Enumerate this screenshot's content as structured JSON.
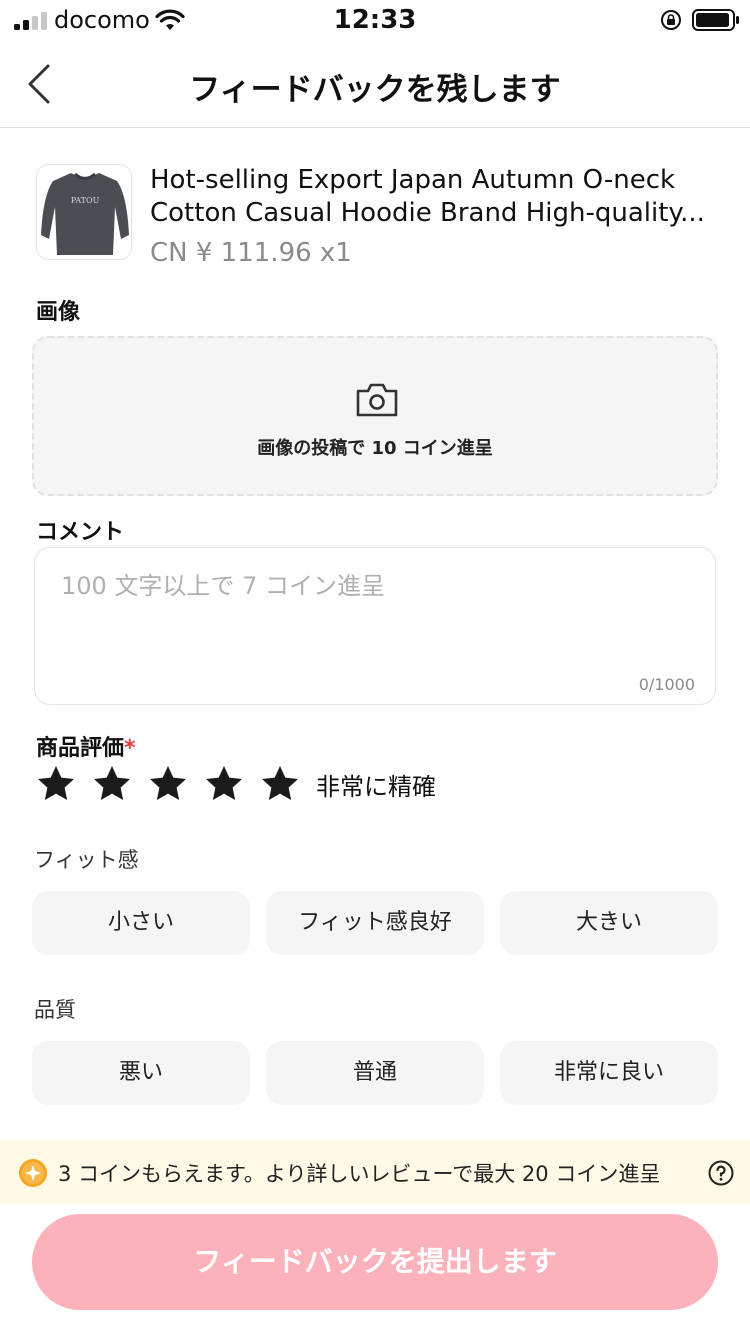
{
  "status_bar": {
    "carrier": "docomo",
    "time": "12:33"
  },
  "nav": {
    "title": "フィードバックを残します",
    "back_icon": "chevron-left-icon"
  },
  "product": {
    "shirt_print": "PATOU",
    "name": "Hot-selling Export Japan Autumn O-neck Cotton Casual Hoodie Brand High-quality...",
    "price": "CN ¥ 111.96 x1"
  },
  "image_section": {
    "label": "画像",
    "upload_text": "画像の投稿で 10 コイン進呈",
    "icon": "camera-icon"
  },
  "comment_section": {
    "label": "コメント",
    "placeholder": "100 文字以上で 7 コイン進呈",
    "value": "",
    "counter": "0/1000"
  },
  "rating_section": {
    "label": "商品評価",
    "required_mark": "*",
    "stars_filled": 5,
    "stars_total": 5,
    "rating_text": "非常に精確",
    "star_color": "#1a1a1a"
  },
  "fit_section": {
    "label": "フィット感",
    "options": [
      "小さい",
      "フィット感良好",
      "大きい"
    ]
  },
  "quality_section": {
    "label": "品質",
    "options": [
      "悪い",
      "普通",
      "非常に良い"
    ]
  },
  "coin_banner": {
    "text": "3 コインもらえます。より詳しいレビューで最大 20 コイン進呈",
    "coin_color": "#f5a623",
    "background": "#fff9e6"
  },
  "submit": {
    "label": "フィードバックを提出します",
    "color": "#fbb2bb"
  }
}
